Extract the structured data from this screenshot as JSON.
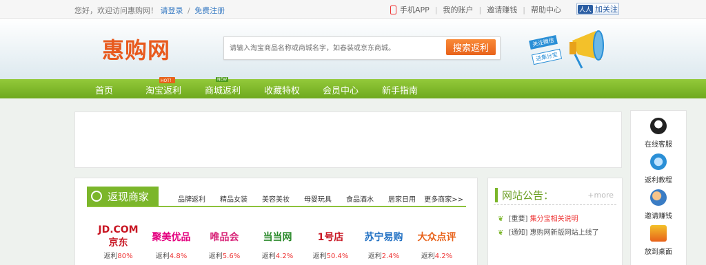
{
  "topbar": {
    "greeting": "您好，欢迎访问惠购网！",
    "login": "请登录",
    "separator": "/",
    "register": "免费注册",
    "links": [
      "手机APP",
      "我的账户",
      "邀请赚钱",
      "帮助中心"
    ],
    "follow_button": "加关注"
  },
  "header": {
    "logo": "惠购网",
    "search": {
      "placeholder": "请输入淘宝商品名称或商城名字，如春装或京东商城。",
      "button": "搜索返利"
    }
  },
  "nav": {
    "items": [
      {
        "label": "首页",
        "badge": ""
      },
      {
        "label": "淘宝返利",
        "badge": "HOT！"
      },
      {
        "label": "商城返利",
        "badge": "NEW"
      },
      {
        "label": "收藏特权",
        "badge": ""
      },
      {
        "label": "会员中心",
        "badge": ""
      },
      {
        "label": "新手指南",
        "badge": ""
      }
    ]
  },
  "merchants": {
    "title": "返现商家",
    "tabs": [
      "品牌返利",
      "精品女装",
      "美容美妆",
      "母婴玩具",
      "食品酒水",
      "居家日用"
    ],
    "more": "更多商家>>",
    "rate_prefix": "返利",
    "items": [
      {
        "name": "JD.COM 京东",
        "rate": "80%",
        "color": "#c81623"
      },
      {
        "name": "聚美优品",
        "rate": "4.8%",
        "color": "#e4007f"
      },
      {
        "name": "唯品会",
        "rate": "5.6%",
        "color": "#d8277a"
      },
      {
        "name": "当当网",
        "rate": "4.2%",
        "color": "#2b8a2b"
      },
      {
        "name": "1号店",
        "rate": "50.4%",
        "color": "#c81623"
      },
      {
        "name": "苏宁易购",
        "rate": "2.4%",
        "color": "#2372c4"
      },
      {
        "name": "大众点评",
        "rate": "4.2%",
        "color": "#e8621a"
      }
    ]
  },
  "notice": {
    "title": "网站公告：",
    "more": "+more",
    "items": [
      {
        "tag": "[重要]",
        "text": "集分宝相关说明"
      },
      {
        "tag": "[通知]",
        "text": "惠购网新版网站上线了"
      }
    ]
  },
  "sidebar": {
    "items": [
      {
        "label": "在线客服",
        "icon": "qq-penguin-icon"
      },
      {
        "label": "返利教程",
        "icon": "tutorial-icon"
      },
      {
        "label": "邀请赚钱",
        "icon": "invite-users-icon"
      },
      {
        "label": "放到桌面",
        "icon": "desktop-icon"
      }
    ]
  },
  "colors": {
    "nav_green": "#7bb62a",
    "brand_orange": "#e8621a",
    "link_blue": "#3a7cc4",
    "rate_red": "#e33333"
  }
}
